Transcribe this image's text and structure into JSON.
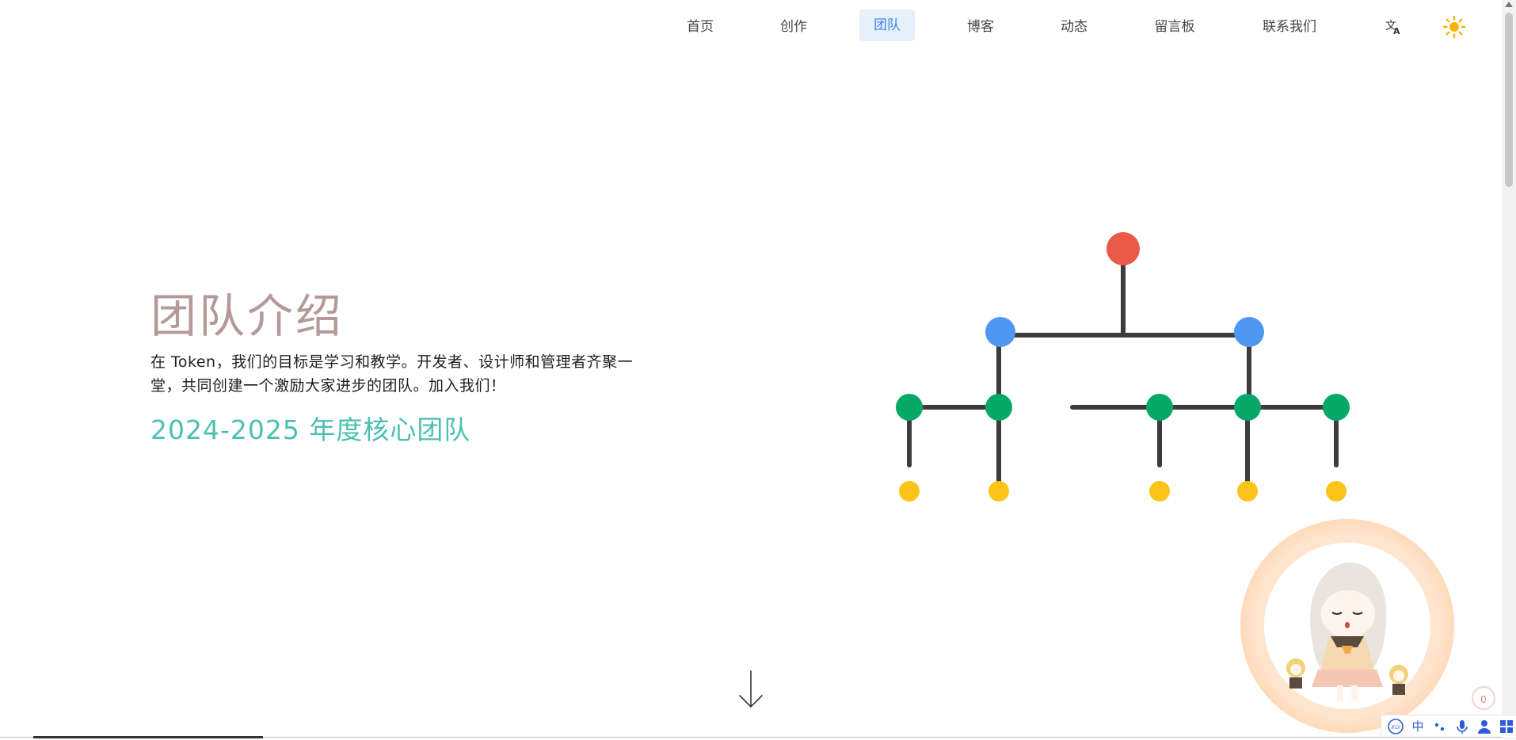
{
  "nav": {
    "items": [
      {
        "label": "首页",
        "active": false
      },
      {
        "label": "创作",
        "active": false
      },
      {
        "label": "团队",
        "active": true
      },
      {
        "label": "博客",
        "active": false
      },
      {
        "label": "动态",
        "active": false
      },
      {
        "label": "留言板",
        "active": false
      },
      {
        "label": "联系我们",
        "active": false
      }
    ],
    "icons": [
      "translate-icon",
      "sun-icon"
    ]
  },
  "hero": {
    "title": "团队介绍",
    "description": "在 Token，我们的目标是学习和教学。开发者、设计师和管理者齐聚一堂，共同创建一个激励大家进步的团队。加入我们！",
    "subtitle": "2024-2025 年度核心团队"
  },
  "tree_colors": {
    "root": "#ea5a47",
    "level1": "#4f97f2",
    "level2": "#05a866",
    "level3": "#fcc419",
    "line": "#3c3c3c"
  },
  "widgets": {
    "counter_value": "0",
    "ime": [
      "iflyt-icon",
      "中",
      "punct-icon",
      "mic-icon",
      "user-icon",
      "grid-icon"
    ]
  },
  "colors": {
    "title": "#b39a98",
    "subtitle": "#4dbfb2",
    "active_nav_bg": "#e6f0fb",
    "active_nav_text": "#3b82f6"
  }
}
